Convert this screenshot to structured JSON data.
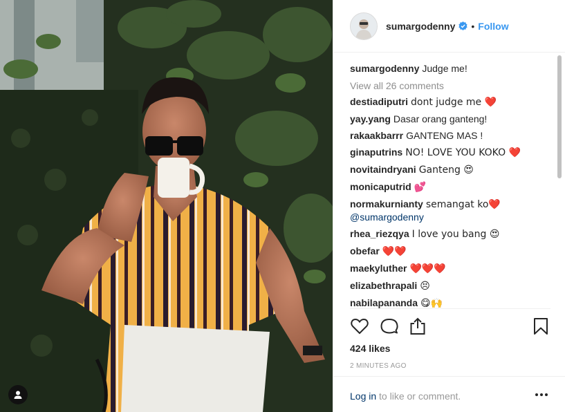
{
  "post": {
    "username": "sumargodenny",
    "verified": true,
    "follow_label": "Follow",
    "separator": "•",
    "caption": {
      "username": "sumargodenny",
      "text": "Judge me!"
    },
    "view_all": "View all 26 comments",
    "comments": [
      {
        "user": "destiadiputri",
        "text": "dont judge me ❤️"
      },
      {
        "user": "yay.yang",
        "text": "Dasar orang ganteng!"
      },
      {
        "user": "rakaakbarrr",
        "text": "GANTENG MAS !"
      },
      {
        "user": "ginaputrins",
        "text": "NO! LOVE YOU KOKO ❤️"
      },
      {
        "user": "novitaindryani",
        "text": "Ganteng 😍"
      },
      {
        "user": "monicaputrid",
        "text": "💕"
      },
      {
        "user": "normakurnianty",
        "text": "semangat ko❤️",
        "mention": "@sumargodenny"
      },
      {
        "user": "rhea_riezqya",
        "text": "I love you bang 😍"
      },
      {
        "user": "obefar",
        "text": "❤️❤️"
      },
      {
        "user": "maekyluther",
        "text": "❤️❤️❤️"
      },
      {
        "user": "elizabethrapali",
        "text": "😣"
      },
      {
        "user": "nabilapananda",
        "text": "😋🙌"
      }
    ],
    "likes": "424 likes",
    "timestamp": "2 MINUTES AGO",
    "login": {
      "link": "Log in",
      "rest": " to like or comment."
    }
  },
  "icons": [
    "heart-icon",
    "comment-icon",
    "share-icon",
    "bookmark-icon",
    "more-options-icon",
    "user-tag-icon",
    "verified-badge-icon"
  ],
  "colors": {
    "accent": "#3897f0",
    "link": "#003569",
    "muted": "#8e8e8e",
    "text": "#262626"
  }
}
